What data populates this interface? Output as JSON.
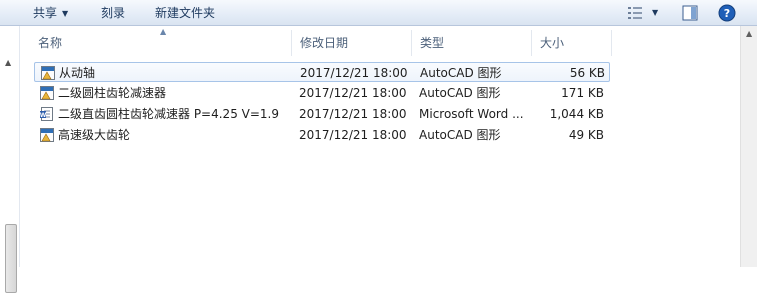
{
  "toolbar": {
    "share_label": "共享",
    "burn_label": "刻录",
    "newfolder_label": "新建文件夹",
    "view_icon": "view-options-icon",
    "preview_icon": "preview-pane-icon",
    "help_icon": "help-icon"
  },
  "columns": {
    "name": "名称",
    "date": "修改日期",
    "type": "类型",
    "size": "大小"
  },
  "files": [
    {
      "name": "从动轴",
      "date": "2017/12/21 18:00",
      "type": "AutoCAD 图形",
      "size": "56 KB",
      "icon": "autocad-file-icon",
      "selected": true
    },
    {
      "name": "二级圆柱齿轮减速器",
      "date": "2017/12/21 18:00",
      "type": "AutoCAD 图形",
      "size": "171 KB",
      "icon": "autocad-file-icon",
      "selected": false
    },
    {
      "name": "二级直齿圆柱齿轮减速器 P=4.25 V=1.9",
      "date": "2017/12/21 18:00",
      "type": "Microsoft Word ...",
      "size": "1,044 KB",
      "icon": "word-file-icon",
      "selected": false
    },
    {
      "name": "高速级大齿轮",
      "date": "2017/12/21 18:00",
      "type": "AutoCAD 图形",
      "size": "49 KB",
      "icon": "autocad-file-icon",
      "selected": false
    }
  ],
  "colors": {
    "toolbar_text": "#1e3a5f",
    "selection_border": "#a7c4e8",
    "header_text": "#4c607a"
  }
}
